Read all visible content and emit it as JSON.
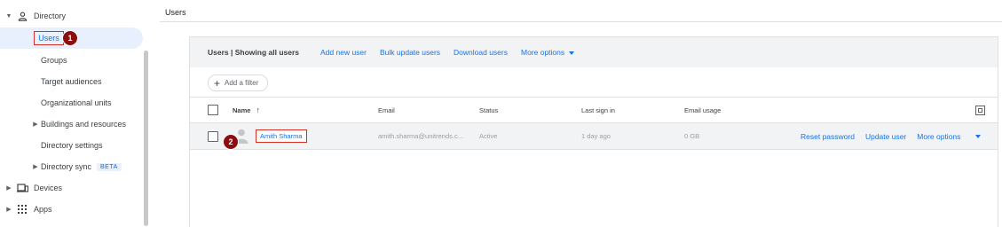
{
  "sidebar": {
    "directory": {
      "label": "Directory",
      "icon": "person-icon"
    },
    "items": [
      {
        "label": "Users"
      },
      {
        "label": "Groups"
      },
      {
        "label": "Target audiences"
      },
      {
        "label": "Organizational units"
      },
      {
        "label": "Buildings and resources"
      },
      {
        "label": "Directory settings"
      },
      {
        "label": "Directory sync",
        "badge": "BETA"
      }
    ],
    "devices": {
      "label": "Devices",
      "icon": "devices-icon"
    },
    "apps": {
      "label": "Apps",
      "icon": "apps-grid-icon"
    }
  },
  "main": {
    "title": "Users"
  },
  "toolbar": {
    "title": "Users | Showing all users",
    "add_new_user": "Add new user",
    "bulk_update_users": "Bulk update users",
    "download_users": "Download users",
    "more_options": "More options"
  },
  "filter": {
    "label": "Add a filter"
  },
  "table": {
    "headers": {
      "name": "Name",
      "email": "Email",
      "status": "Status",
      "last_sign_in": "Last sign in",
      "email_usage": "Email usage"
    },
    "rows": [
      {
        "name": "Amith Sharma",
        "email": "amith.sharma@unitrends.c...",
        "status": "Active",
        "last_sign_in": "1 day ago",
        "email_usage": "0 GB",
        "actions": {
          "reset_password": "Reset password",
          "update_user": "Update user",
          "more_options": "More options"
        }
      }
    ]
  },
  "annotations": {
    "step1": "1",
    "step2": "2"
  },
  "colors": {
    "accent": "#1a73e8",
    "active_bg": "#e8f0fe",
    "highlight_box": "#d93025",
    "step_badge": "#8b0d0d"
  }
}
